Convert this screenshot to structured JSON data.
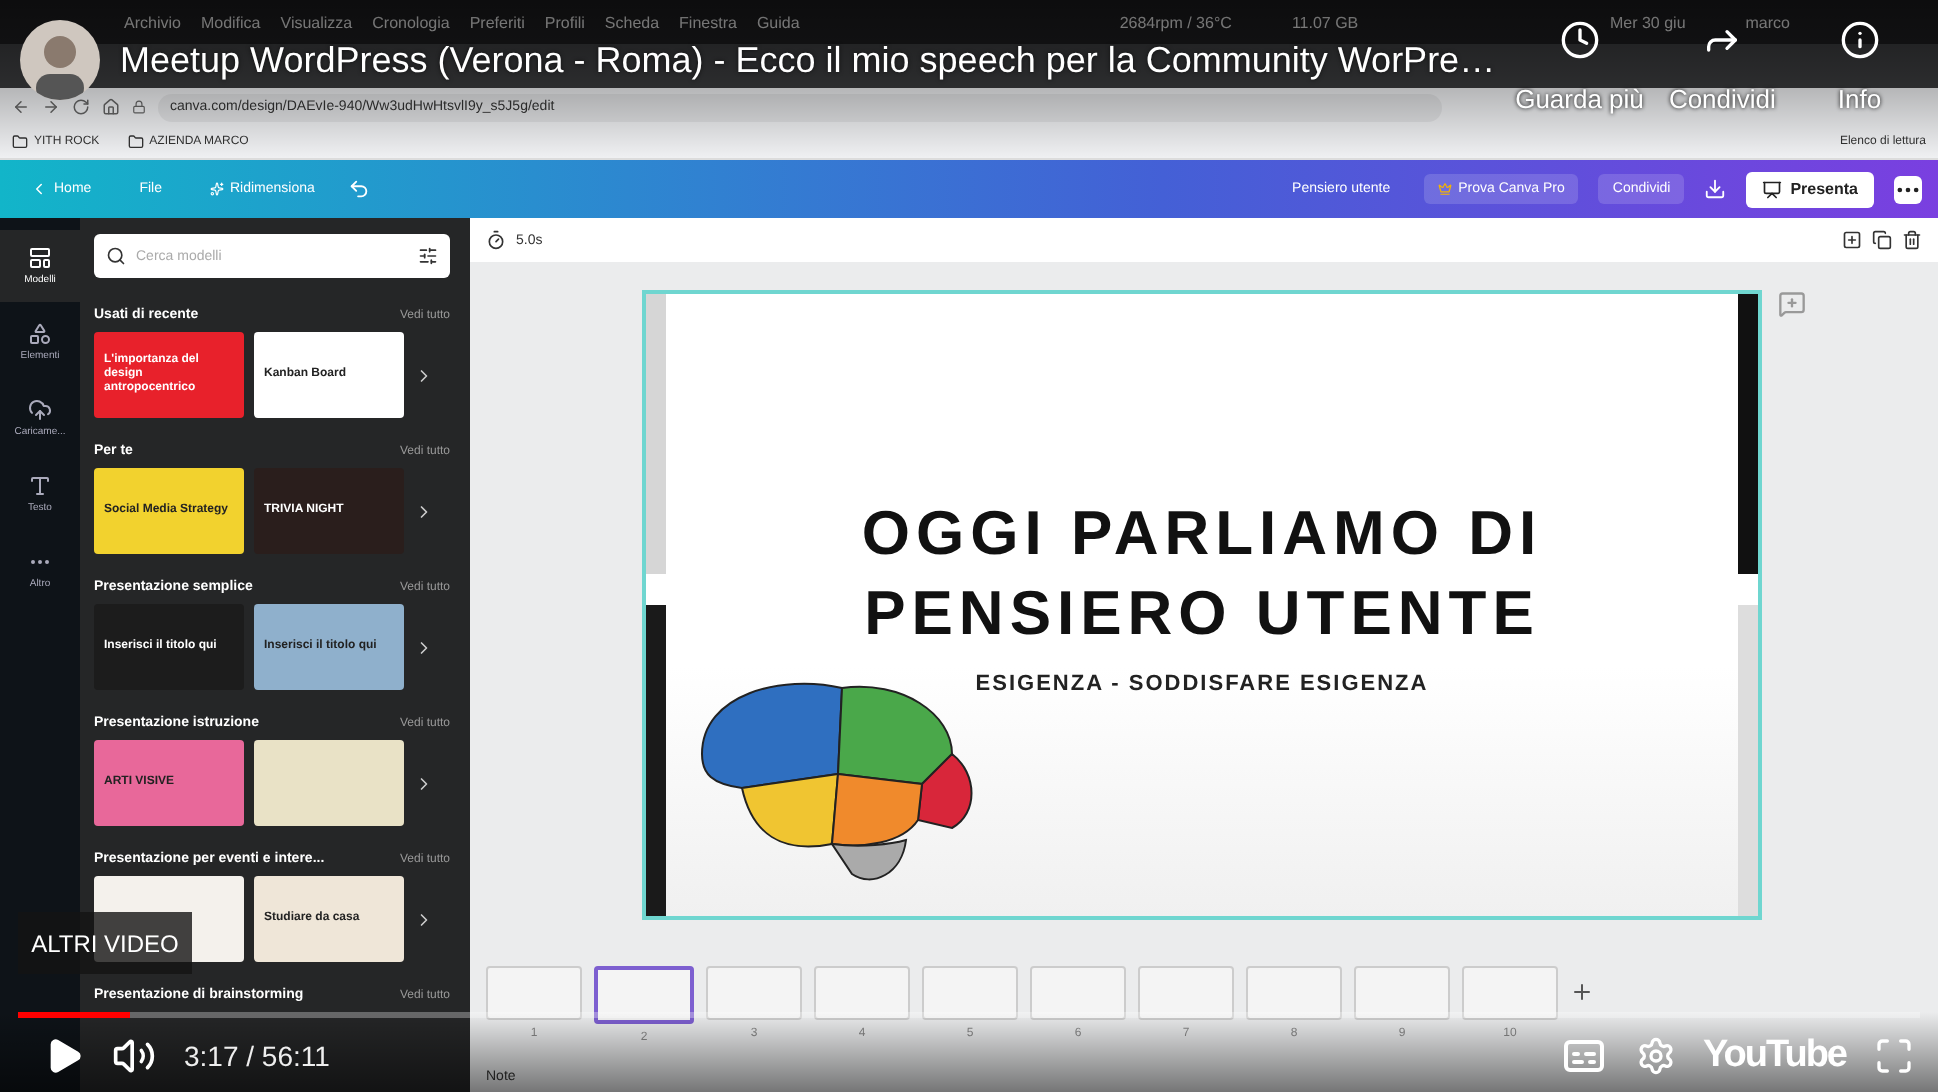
{
  "video": {
    "menubar": {
      "items": [
        "Archivio",
        "Modifica",
        "Visualizza",
        "Cronologia",
        "Preferiti",
        "Profili",
        "Scheda",
        "Finestra",
        "Guida"
      ],
      "status": [
        "2684rpm / 36°C",
        "11.07 GB",
        "Mer 30 giu",
        "marco"
      ]
    },
    "address_bar": {
      "url": "canva.com/design/DAEvIe-940/Ww3udHwHtsvlI9y_s5J5g/edit"
    },
    "bookmarks": [
      "YITH ROCK",
      "AZIENDA MARCO"
    ],
    "reading_list": "Elenco di lettura",
    "editor_toolbar": {
      "nav": [
        "Home",
        "File",
        "Ridimensiona"
      ],
      "design_title": "Pensiero utente",
      "upgrade": "Prova Canva Pro",
      "share": "Condividi",
      "present": "Presenta"
    },
    "side_rail": [
      {
        "label": "Modelli",
        "kind": "templates",
        "selected": true
      },
      {
        "label": "Elementi",
        "kind": "elements",
        "selected": false
      },
      {
        "label": "Caricame...",
        "kind": "uploads",
        "selected": false
      },
      {
        "label": "Testo",
        "kind": "text",
        "selected": false
      },
      {
        "label": "Altro",
        "kind": "more",
        "selected": false
      }
    ],
    "templates_panel": {
      "placeholder": "Cerca modelli",
      "sections": [
        {
          "title": "Usati di recente",
          "link": "Vedi tutto",
          "cards": [
            {
              "text": "L'importanza del design antropocentrico",
              "color": "#e8212b"
            },
            {
              "text": "Kanban Board",
              "color": "#ffffff"
            }
          ]
        },
        {
          "title": "Per te",
          "link": "Vedi tutto",
          "cards": [
            {
              "text": "Social Media Strategy",
              "color": "#f2d22e"
            },
            {
              "text": "TRIVIA NIGHT",
              "color": "#2a1e1c"
            }
          ]
        },
        {
          "title": "Presentazione semplice",
          "link": "Vedi tutto",
          "cards": [
            {
              "text": "Inserisci il titolo qui",
              "color": "#1c1c1c"
            },
            {
              "text": "Inserisci il titolo qui",
              "color": "#8fb0cc"
            }
          ]
        },
        {
          "title": "Presentazione istruzione",
          "link": "Vedi tutto",
          "cards": [
            {
              "text": "ARTI VISIVE",
              "color": "#e8689a"
            },
            {
              "color": "#e9e2c6"
            }
          ]
        },
        {
          "title": "Presentazione per eventi e intere...",
          "link": "Vedi tutto",
          "cards": [
            {
              "color": "#f4f1ec"
            },
            {
              "text": "Studiare da casa",
              "color": "#efe6d8"
            }
          ]
        },
        {
          "title": "Presentazione di brainstorming",
          "link": "Vedi tutto"
        }
      ]
    },
    "page_toolbar": {
      "duration": "5.0s"
    },
    "slide": {
      "title_lines": [
        "OGGI PARLIAMO DI",
        "PENSIERO UTENTE"
      ],
      "subtitle": "ESIGENZA - SODDISFARE ESIGENZA"
    },
    "pages": [
      {
        "number": "1",
        "selected": false
      },
      {
        "number": "2",
        "selected": true
      },
      {
        "number": "3",
        "selected": false
      },
      {
        "number": "4",
        "selected": false
      },
      {
        "number": "5",
        "selected": false
      },
      {
        "number": "6",
        "selected": false
      },
      {
        "number": "7",
        "selected": false
      },
      {
        "number": "8",
        "selected": false
      },
      {
        "number": "9",
        "selected": false
      },
      {
        "number": "10",
        "selected": false
      }
    ],
    "notes": "Note"
  },
  "player": {
    "title": "Meetup WordPress (Verona - Roma) - Ecco il mio speech per la Community WorPre…",
    "actions": [
      {
        "kind": "watch_later",
        "label": "Guarda più"
      },
      {
        "kind": "share",
        "label": "Condividi"
      },
      {
        "kind": "info",
        "label": "Info"
      }
    ],
    "more_videos": "ALTRI VIDEO",
    "progress": {
      "level": 0.059
    },
    "time": "3:17 / 56:11",
    "logo": "YouTube"
  }
}
